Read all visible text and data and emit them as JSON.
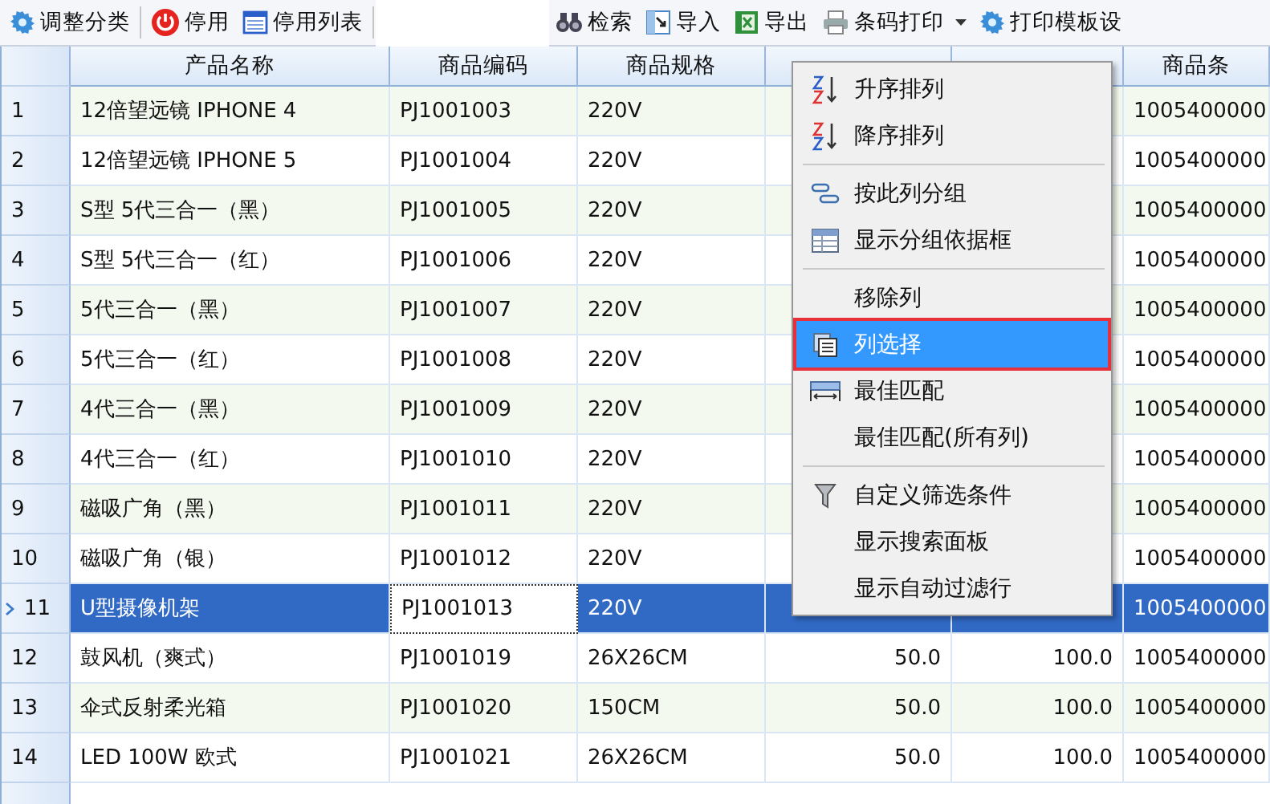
{
  "toolbar": [
    {
      "label": "调整分类"
    },
    {
      "label": "停用"
    },
    {
      "label": "停用列表"
    },
    {
      "label": "检索"
    },
    {
      "label": "导入"
    },
    {
      "label": "导出"
    },
    {
      "label": "条码打印",
      "dropdown": true
    },
    {
      "label": "打印模板设"
    }
  ],
  "table": {
    "columns": [
      {
        "label": "产品名称"
      },
      {
        "label": "商品编码"
      },
      {
        "label": "商品规格"
      },
      {},
      {},
      {
        "label": "商品条"
      }
    ],
    "rows": [
      {
        "number": "1",
        "name": "12倍望远镜  IPHONE 4",
        "code": "PJ1001003",
        "spec": "220V",
        "barcode": "1005400000",
        "selected": false
      },
      {
        "number": "2",
        "name": "12倍望远镜  IPHONE 5",
        "code": "PJ1001004",
        "spec": "220V",
        "barcode": "1005400000",
        "selected": false
      },
      {
        "number": "3",
        "name": "S型 5代三合一（黑）",
        "code": "PJ1001005",
        "spec": "220V",
        "barcode": "1005400000",
        "selected": false
      },
      {
        "number": "4",
        "name": "S型 5代三合一（红）",
        "code": "PJ1001006",
        "spec": "220V",
        "barcode": "1005400000",
        "selected": false
      },
      {
        "number": "5",
        "name": "5代三合一（黑）",
        "code": "PJ1001007",
        "spec": "220V",
        "barcode": "1005400000",
        "selected": false
      },
      {
        "number": "6",
        "name": "5代三合一（红）",
        "code": "PJ1001008",
        "spec": "220V",
        "barcode": "1005400000",
        "selected": false
      },
      {
        "number": "7",
        "name": "4代三合一（黑）",
        "code": "PJ1001009",
        "spec": "220V",
        "barcode": "1005400000",
        "selected": false
      },
      {
        "number": "8",
        "name": "4代三合一（红）",
        "code": "PJ1001010",
        "spec": "220V",
        "barcode": "1005400000",
        "selected": false
      },
      {
        "number": "9",
        "name": "磁吸广角（黑）",
        "code": "PJ1001011",
        "spec": "220V",
        "barcode": "1005400000",
        "selected": false
      },
      {
        "number": "10",
        "name": "磁吸广角（银）",
        "code": "PJ1001012",
        "spec": "220V",
        "barcode": "1005400000",
        "selected": false
      },
      {
        "number": "11",
        "name": "U型摄像机架",
        "code": "PJ1001013",
        "spec": "220V",
        "barcode": "1005400000",
        "selected": true
      },
      {
        "number": "12",
        "name": "鼓风机（爽式）",
        "code": "PJ1001019",
        "spec": "26X26CM",
        "cost": "50.0",
        "price": "100.0",
        "barcode": "1005400000",
        "selected": false
      },
      {
        "number": "13",
        "name": "伞式反射柔光箱",
        "code": "PJ1001020",
        "spec": "150CM",
        "cost": "50.0",
        "price": "100.0",
        "barcode": "1005400000",
        "selected": false
      },
      {
        "number": "14",
        "name": "LED 100W 欧式",
        "code": "PJ1001021",
        "spec": "26X26CM",
        "cost": "50.0",
        "price": "100.0",
        "barcode": "1005400000",
        "selected": false
      }
    ]
  },
  "context_menu": {
    "groups": [
      [
        {
          "label": "升序排列",
          "selected": false
        },
        {
          "label": "降序排列",
          "selected": false
        }
      ],
      [
        {
          "label": "按此列分组",
          "selected": false
        },
        {
          "label": "显示分组依据框",
          "selected": false
        }
      ],
      [
        {
          "label": "移除列",
          "selected": false
        },
        {
          "label": "列选择",
          "selected": true
        },
        {
          "label": "最佳匹配",
          "selected": false
        },
        {
          "label": "最佳匹配(所有列)",
          "selected": false
        }
      ],
      [
        {
          "label": "自定义筛选条件",
          "selected": false
        },
        {
          "label": "显示搜索面板",
          "selected": false
        },
        {
          "label": "显示自动过滤行",
          "selected": false
        }
      ]
    ]
  }
}
